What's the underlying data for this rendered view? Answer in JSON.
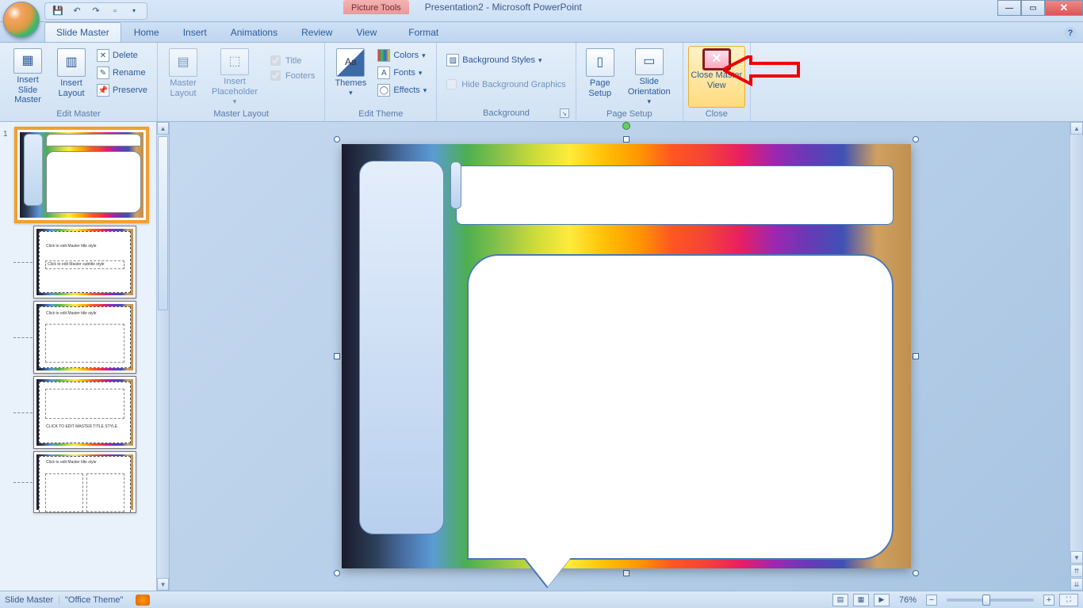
{
  "titlebar": {
    "context_tab": "Picture Tools",
    "document_title": "Presentation2 - Microsoft PowerPoint"
  },
  "tabs": {
    "slide_master": "Slide Master",
    "home": "Home",
    "insert": "Insert",
    "animations": "Animations",
    "review": "Review",
    "view": "View",
    "format": "Format"
  },
  "ribbon": {
    "edit_master": {
      "insert_slide_master": "Insert Slide Master",
      "insert_layout": "Insert Layout",
      "delete": "Delete",
      "rename": "Rename",
      "preserve": "Preserve",
      "label": "Edit Master"
    },
    "master_layout": {
      "master_layout": "Master Layout",
      "insert_placeholder": "Insert Placeholder",
      "title": "Title",
      "footers": "Footers",
      "label": "Master Layout"
    },
    "edit_theme": {
      "themes": "Themes",
      "colors": "Colors",
      "fonts": "Fonts",
      "effects": "Effects",
      "label": "Edit Theme"
    },
    "background": {
      "background_styles": "Background Styles",
      "hide_bg_graphics": "Hide Background Graphics",
      "label": "Background"
    },
    "page_setup": {
      "page_setup": "Page Setup",
      "slide_orientation": "Slide Orientation",
      "label": "Page Setup"
    },
    "close": {
      "close_master_view": "Close Master View",
      "label": "Close"
    }
  },
  "thumbnails": {
    "master_num": "1",
    "layout1": "Click to edit Master title style",
    "layout1_sub": "Click to edit Master subtitle style",
    "layout2": "Click to edit Master title style",
    "layout3": "CLICK TO EDIT MASTER TITLE STYLE",
    "layout4": "Click to edit Master title style"
  },
  "statusbar": {
    "mode": "Slide Master",
    "theme": "\"Office Theme\"",
    "zoom": "76%"
  }
}
